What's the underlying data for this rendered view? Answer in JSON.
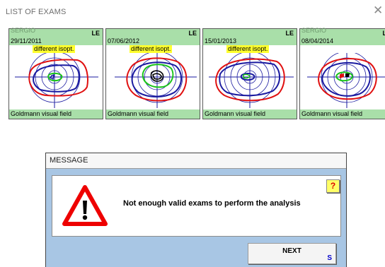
{
  "window": {
    "title": "LIST OF EXAMS",
    "close_icon": "close-icon"
  },
  "exams": [
    {
      "name": "SERGIO",
      "date": "29/11/2011",
      "eye": "LE",
      "badge": "different isopt.",
      "footer": "Goldmann visual field"
    },
    {
      "name": "",
      "date": "07/06/2012",
      "eye": "LE",
      "badge": "different isopt.",
      "footer": "Goldmann visual field"
    },
    {
      "name": "",
      "date": "15/01/2013",
      "eye": "LE",
      "badge": "different isopt.",
      "footer": "Goldmann visual field"
    },
    {
      "name": "SERGIO",
      "date": "08/04/2014",
      "eye": "LE",
      "badge": "",
      "footer": "Goldmann visual field"
    }
  ],
  "dialog": {
    "title": "MESSAGE",
    "message": "Not enough valid exams to perform the analysis",
    "help_label": "?",
    "next_label": "NEXT",
    "next_shortcut": "S",
    "warning_icon": "warning-icon"
  },
  "colors": {
    "card_header": "#a9dfa9",
    "badge": "#ffff2e",
    "dialog_bg": "#a8c6e4",
    "isopter_red": "#e01010",
    "isopter_blue": "#1a1aa0",
    "isopter_green": "#19c419"
  }
}
